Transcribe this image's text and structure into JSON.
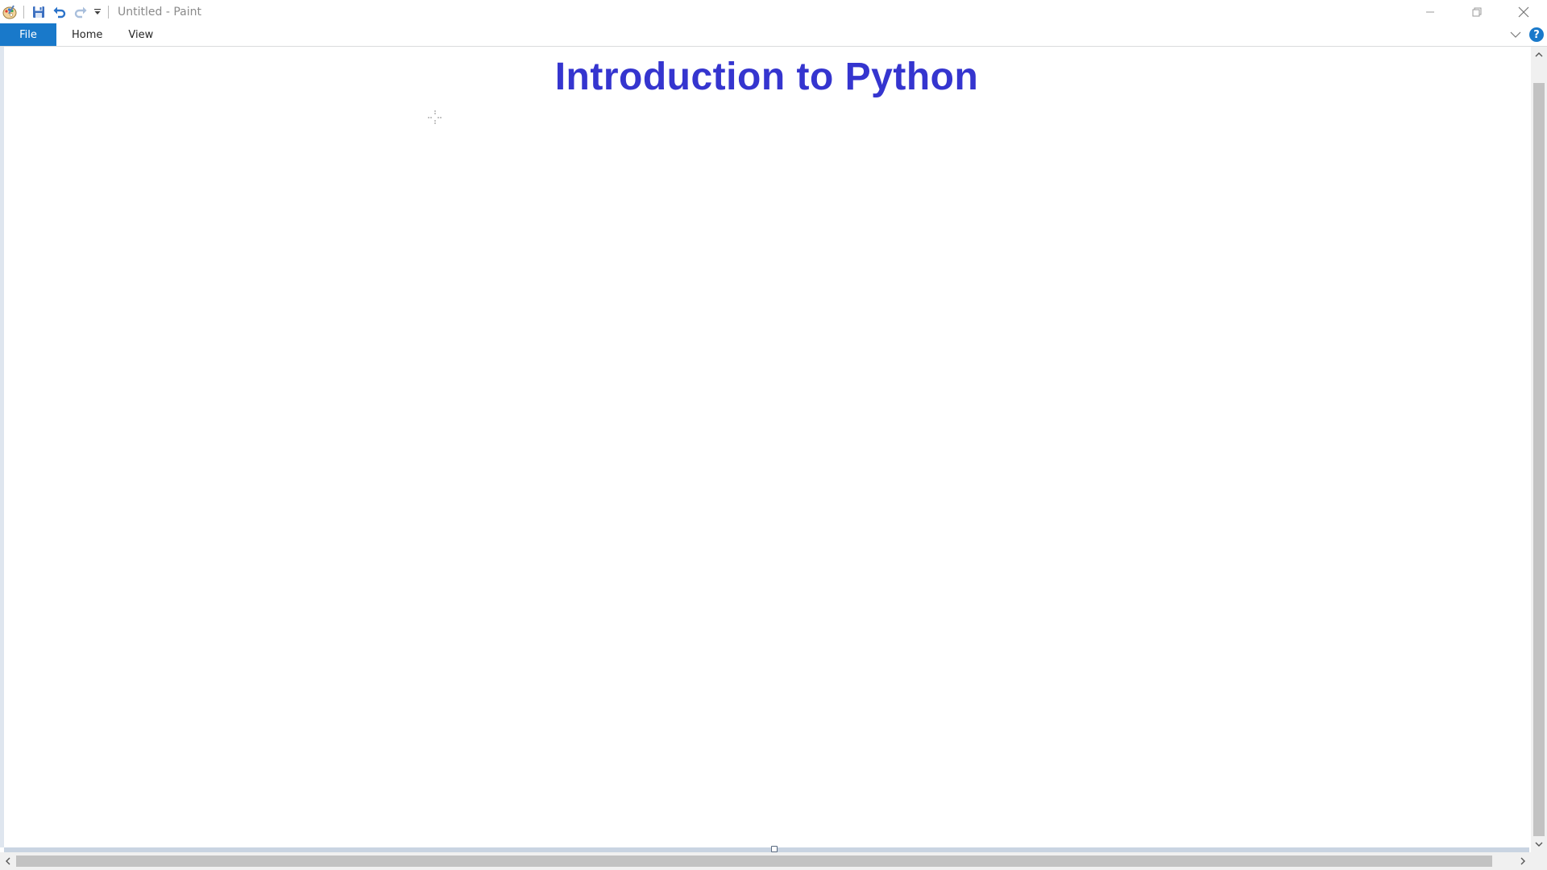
{
  "window": {
    "title": "Untitled - Paint"
  },
  "ribbon": {
    "tabs": [
      {
        "label": "File",
        "active": true
      },
      {
        "label": "Home",
        "active": false
      },
      {
        "label": "View",
        "active": false
      }
    ],
    "help_label": "?"
  },
  "canvas": {
    "heading": "Introduction to Python",
    "heading_color": "#3535cf",
    "background": "#ffffff"
  },
  "colors": {
    "accent": "#1979ca",
    "title_text": "#8a8a8a"
  },
  "icons": {
    "app": "paint-palette-icon",
    "save": "save-icon",
    "undo": "undo-icon",
    "redo": "redo-icon",
    "customize": "customize-qat-dropdown-icon",
    "minimize": "minimize-icon",
    "restore": "restore-icon",
    "close": "close-icon",
    "collapse_ribbon": "chevron-down-icon",
    "help": "help-icon",
    "cursor": "crosshair-cursor-icon"
  }
}
